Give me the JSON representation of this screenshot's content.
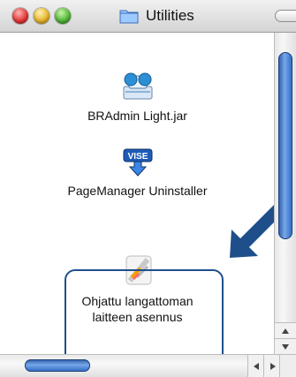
{
  "window": {
    "title": "Utilities",
    "title_icon": "folder-icon",
    "controls": [
      "close-button",
      "minimize-button",
      "zoom-button"
    ]
  },
  "items": [
    {
      "label": "BRAdmin Light.jar",
      "icon": "bradmin-icon"
    },
    {
      "label": "PageManager Uninstaller",
      "icon": "vise-installer-icon",
      "icon_text": "VISE"
    },
    {
      "label_line1": "Ohjattu langattoman",
      "label_line2": "laitteen asennus",
      "icon": "wizard-app-icon",
      "selected": true
    }
  ],
  "annotation": {
    "type": "arrow",
    "color": "#1f4f8a"
  },
  "colors": {
    "accent": "#1f4f8a",
    "scroll_thumb": "#3f7bd6"
  }
}
